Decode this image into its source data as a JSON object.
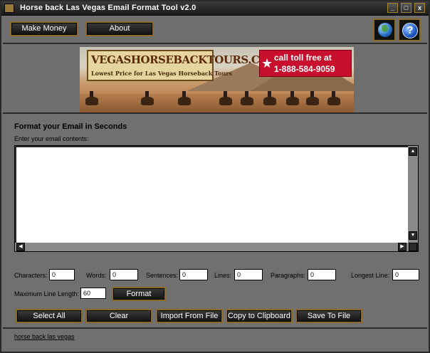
{
  "window": {
    "title": "Horse back Las Vegas Email Format Tool  v2.0",
    "controls": [
      "_",
      "□",
      "x"
    ]
  },
  "toolbar": {
    "make_money": "Make Money",
    "about": "About",
    "globe_icon": "globe-icon",
    "help_icon": "help-icon"
  },
  "banner": {
    "logo_title": "VEGASHORSEBACKTOURS.COM",
    "logo_sub": "Lowest Price for Las Vegas Horseback Tours",
    "call_top": "call toll free at",
    "call_number": "1-888-584-9059"
  },
  "main": {
    "heading": "Format your Email in Seconds",
    "subheading": "Enter your email contents:",
    "email_value": ""
  },
  "stats": {
    "characters_label": "Characters:",
    "characters_value": "0",
    "words_label": "Words:",
    "words_value": "0",
    "sentences_label": "Sentences:",
    "sentences_value": "0",
    "lines_label": "Lines:",
    "lines_value": "0",
    "paragraphs_label": "Paragraphs:",
    "paragraphs_value": "0",
    "longest_label": "Longest Line:",
    "longest_value": "0",
    "maxlen_label": "Maximum Line Length:",
    "maxlen_value": "60",
    "format_button": "Format"
  },
  "actions": {
    "select_all": "Select All",
    "clear": "Clear",
    "import": "Import From File",
    "copy": "Copy to Clipboard",
    "save": "Save To File"
  },
  "footer": {
    "link": "horse back las vegas"
  },
  "colors": {
    "accent_border": "#8a6a28",
    "panel_bg": "#707070",
    "button_bg": "#111111",
    "callout_red": "#c8102e"
  }
}
